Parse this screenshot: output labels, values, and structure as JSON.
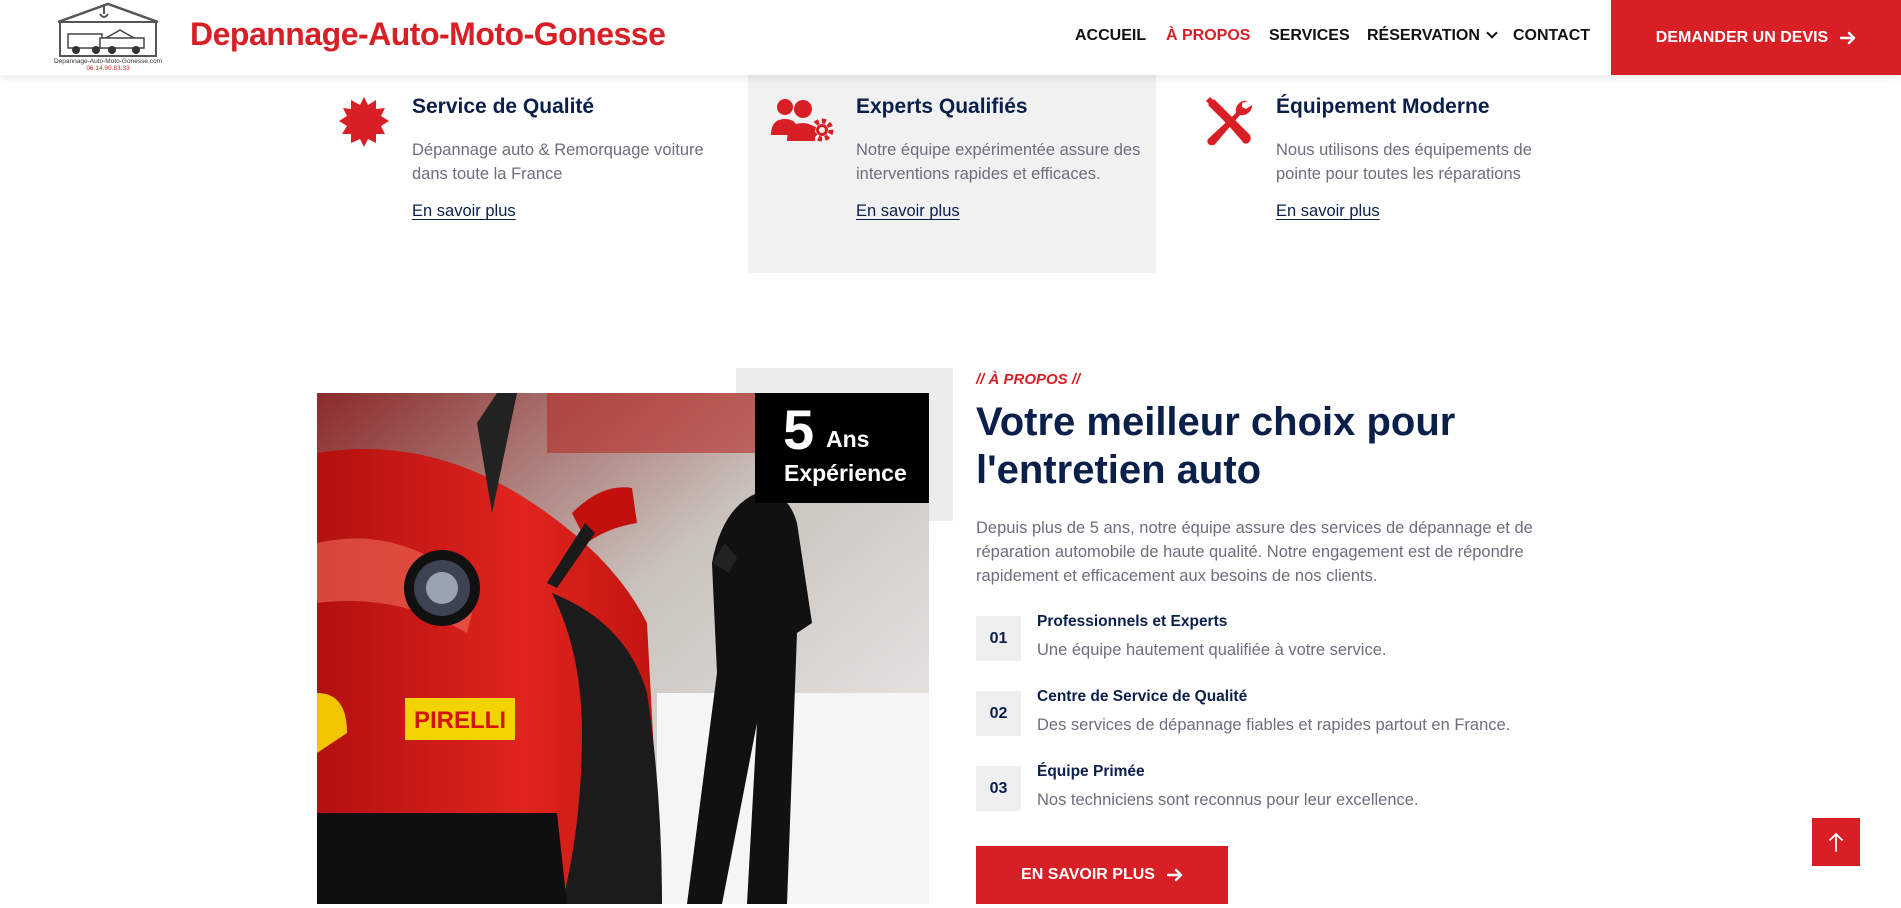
{
  "header": {
    "logo_caption": "Depannage-Auto-Moto-Gonesse.com",
    "logo_phone": "06.14.90.83.33",
    "brand": "Depannage-Auto-Moto-Gonesse",
    "nav": [
      {
        "label": "ACCUEIL",
        "active": false
      },
      {
        "label": "À PROPOS",
        "active": true
      },
      {
        "label": "SERVICES",
        "active": false
      },
      {
        "label": "RÉSERVATION",
        "active": false
      },
      {
        "label": "CONTACT",
        "active": false
      }
    ],
    "cta_label": "DEMANDER UN DEVIS",
    "cta_icon": "arrow-right-icon"
  },
  "features": [
    {
      "icon": "badge-star-icon",
      "title": "Service de Qualité",
      "desc": "Dépannage auto & Remorquage voiture dans toute la France",
      "link": "En savoir plus"
    },
    {
      "icon": "users-gear-icon",
      "title": "Experts Qualifiés",
      "desc": "Notre équipe expérimentée assure des interventions rapides et efficaces.",
      "link": "En savoir plus"
    },
    {
      "icon": "tools-icon",
      "title": "Équipement Moderne",
      "desc": "Nous utilisons des équipements de pointe pour toutes les réparations",
      "link": "En savoir plus"
    }
  ],
  "about": {
    "experience_number": "5",
    "experience_unit": "Ans",
    "experience_label": "Expérience",
    "photo_sponsor_1": "PIRELLI",
    "kicker": "// À PROPOS //",
    "title": "Votre meilleur choix pour l'entretien auto",
    "paragraph": "Depuis plus de 5 ans, notre équipe assure des services de dépannage et de réparation automobile de haute qualité. Notre engagement est de répondre rapidement et efficacement aux besoins de nos clients.",
    "items": [
      {
        "num": "01",
        "title": "Professionnels et Experts",
        "desc": "Une équipe hautement qualifiée à votre service."
      },
      {
        "num": "02",
        "title": "Centre de Service de Qualité",
        "desc": "Des services de dépannage fiables et rapides partout en France."
      },
      {
        "num": "03",
        "title": "Équipe Primée",
        "desc": "Nos techniciens sont reconnus pour leur excellence."
      }
    ],
    "button_label": "EN SAVOIR PLUS"
  },
  "scroll_top_icon": "arrow-up-icon",
  "colors": {
    "accent": "#d81f26",
    "navy": "#0b1f4b",
    "text": "#6b6f7b",
    "shade": "#f1f1f1"
  }
}
